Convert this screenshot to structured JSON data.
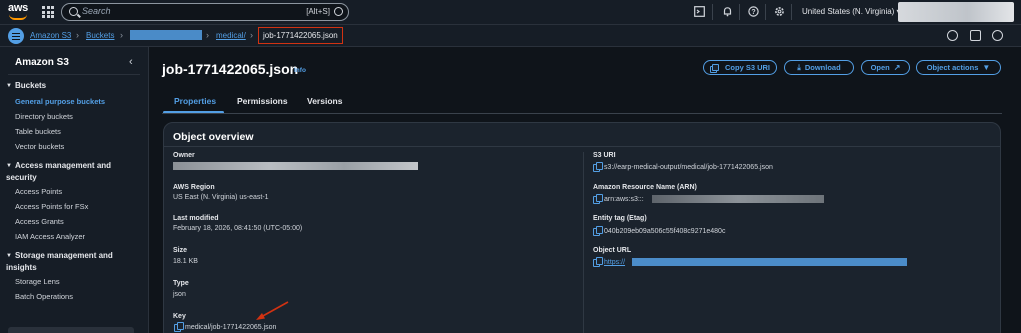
{
  "topnav": {
    "logo_text": "aws",
    "search_placeholder": "Search",
    "search_shortcut": "[Alt+S]",
    "region": "United States (N. Virginia) ▾"
  },
  "breadcrumb": {
    "items": [
      "Amazon S3",
      "Buckets",
      "medical/"
    ],
    "current": "job-1771422065.json"
  },
  "sidebar": {
    "title": "Amazon S3",
    "sections": [
      {
        "label": "Buckets",
        "items": [
          "General purpose buckets",
          "Directory buckets",
          "Table buckets",
          "Vector buckets"
        ],
        "active": "General purpose buckets"
      },
      {
        "label": "Access management and security",
        "items": [
          "Access Points",
          "Access Points for FSx",
          "Access Grants",
          "IAM Access Analyzer"
        ]
      },
      {
        "label": "Storage management and insights",
        "items": [
          "Storage Lens",
          "Batch Operations"
        ]
      }
    ]
  },
  "header": {
    "title": "job-1771422065.json",
    "info": "Info",
    "buttons": {
      "copy_uri": "Copy S3 URI",
      "download": "Download",
      "open": "Open",
      "object_actions": "Object actions"
    }
  },
  "tabs": [
    "Properties",
    "Permissions",
    "Versions"
  ],
  "overview": {
    "title": "Object overview",
    "left": {
      "owner_label": "Owner",
      "region_label": "AWS Region",
      "region_value": "US East (N. Virginia) us-east-1",
      "modified_label": "Last modified",
      "modified_value": "February 18, 2026, 08:41:50 (UTC-05:00)",
      "size_label": "Size",
      "size_value": "18.1 KB",
      "type_label": "Type",
      "type_value": "json",
      "key_label": "Key",
      "key_value": "medical/job-1771422065.json"
    },
    "right": {
      "uri_label": "S3 URI",
      "uri_value": "s3://earp-medical-output/medical/job-1771422065.json",
      "arn_label": "Amazon Resource Name (ARN)",
      "arn_value": "arn:aws:s3:::",
      "etag_label": "Entity tag (Etag)",
      "etag_value": "040b209eb09a506c55f408c9271e480c",
      "url_label": "Object URL",
      "url_value": "https://"
    }
  },
  "colors": {
    "accent": "#539fe5",
    "highlight": "#d13212",
    "background": "#0f141a"
  }
}
